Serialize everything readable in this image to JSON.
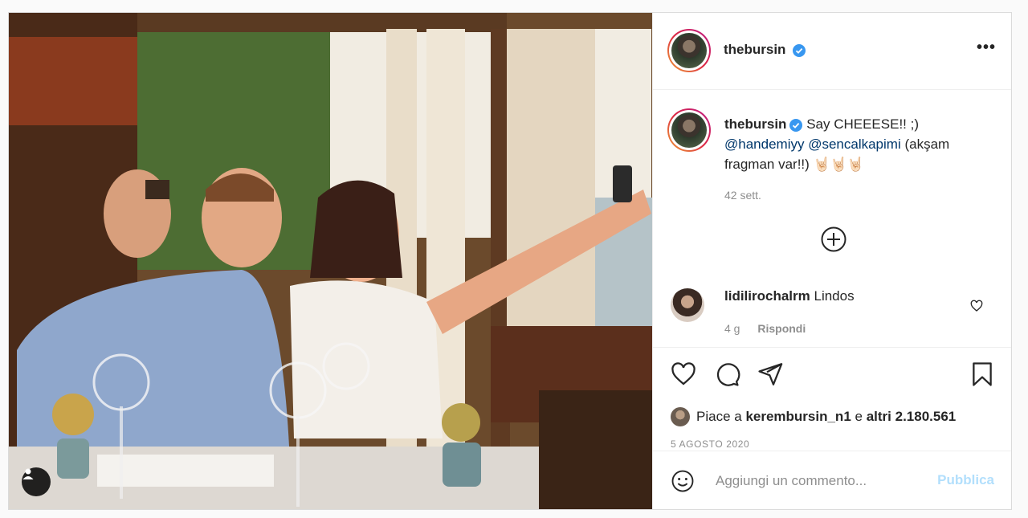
{
  "header": {
    "username": "thebursin",
    "verified": true,
    "more_label": "•••"
  },
  "caption": {
    "username": "thebursin",
    "text": "Say CHEEESE!! ;)",
    "mention1": "@handemiyy",
    "mention2": "@sencalkapimi",
    "rest": "(akşam fragman var!!) 🤘🏻🤘🏻🤘🏻",
    "time": "42 sett."
  },
  "load_more_icon": "plus-circle-icon",
  "comment": {
    "username": "lidilirochalrm",
    "text": "Lindos",
    "time": "4 g",
    "reply_label": "Rispondi"
  },
  "actions": {
    "icons": [
      "heart-icon",
      "comment-icon",
      "share-icon",
      "bookmark-icon"
    ]
  },
  "likes": {
    "prefix": "Piace a",
    "user": "kerembursin_n1",
    "middle": "e",
    "others": "altri 2.180.561"
  },
  "date": "5 AGOSTO 2020",
  "add_comment": {
    "placeholder": "Aggiungi un commento...",
    "publish_label": "Pubblica"
  },
  "colors": {
    "verified": "#3897f0",
    "mention": "#00376b",
    "muted": "#8e8e8e",
    "publish_disabled": "#b2dffc",
    "border": "#dbdbdb"
  }
}
